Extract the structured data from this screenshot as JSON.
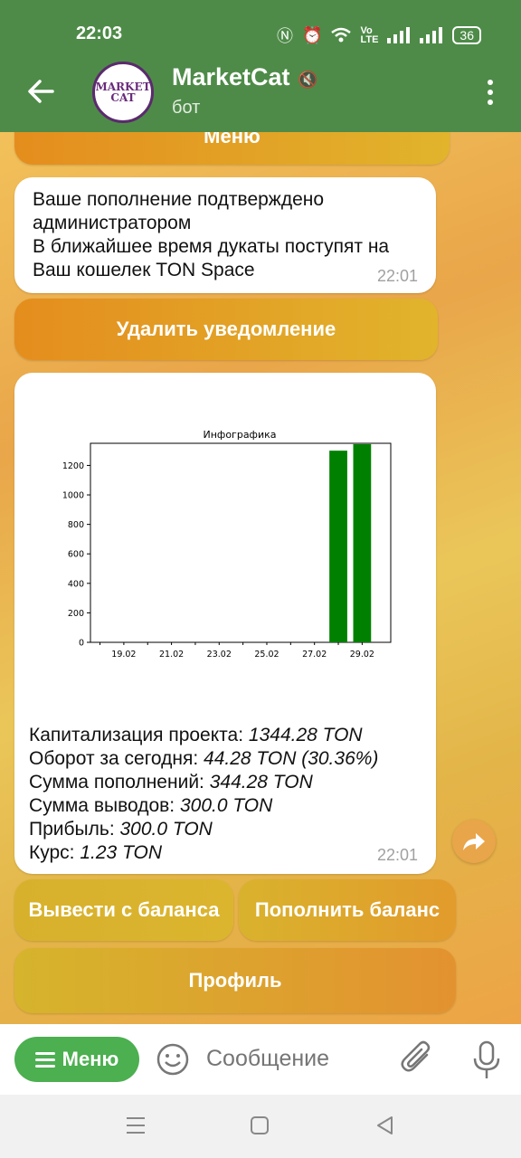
{
  "status_bar": {
    "time": "22:03",
    "battery": "36"
  },
  "header": {
    "title": "MarketCat",
    "subtitle": "бот",
    "avatar_text": [
      "MARKET",
      "CAT"
    ]
  },
  "chat": {
    "top_button": "Меню",
    "message1": {
      "lines": [
        "Ваше пополнение подтверждено",
        "администратором",
        "В ближайшее время дукаты поступят на",
        "Ваш кошелек TON Space"
      ],
      "time": "22:01"
    },
    "delete_button": "Удалить уведомление",
    "message2": {
      "stats": [
        {
          "label": "Капитализация проекта: ",
          "value": "1344.28 TON"
        },
        {
          "label": "Оборот за сегодня: ",
          "value": "44.28 TON (30.36%)"
        },
        {
          "label": "Сумма пополнений: ",
          "value": "344.28 TON"
        },
        {
          "label": "Сумма выводов: ",
          "value": "300.0 TON"
        },
        {
          "label": "Прибыль: ",
          "value": "300.0 TON"
        },
        {
          "label": "Курс: ",
          "value": "1.23 TON"
        }
      ],
      "time": "22:01"
    },
    "buttons": {
      "withdraw": "Вывести с баланса",
      "deposit": "Пополнить баланс",
      "profile": "Профиль"
    }
  },
  "input_bar": {
    "menu_label": "Меню",
    "placeholder": "Сообщение"
  },
  "colors": {
    "header": "#4e8b48",
    "bar": "#008000",
    "menu_button": "#4caf50"
  },
  "chart_data": {
    "type": "bar",
    "title": "Инфографика",
    "xlabel": "",
    "ylabel": "",
    "x_ticks": [
      "19.02",
      "21.02",
      "23.02",
      "25.02",
      "27.02",
      "29.02"
    ],
    "y_ticks": [
      0,
      200,
      400,
      600,
      800,
      1000,
      1200
    ],
    "ylim": [
      0,
      1350
    ],
    "bars": [
      {
        "date": "28.02",
        "value": 1300
      },
      {
        "date": "29.02",
        "value": 1344.28
      }
    ],
    "grid": false
  }
}
